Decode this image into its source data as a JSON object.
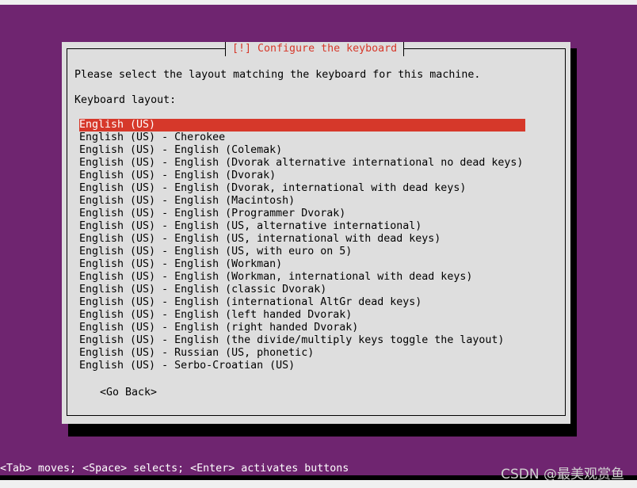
{
  "dialog": {
    "title": "[!] Configure the keyboard",
    "prompt": "Please select the layout matching the keyboard for this machine.",
    "list_label": "Keyboard layout:",
    "selected_index": 0,
    "items": [
      "English (US)",
      "English (US) - Cherokee",
      "English (US) - English (Colemak)",
      "English (US) - English (Dvorak alternative international no dead keys)",
      "English (US) - English (Dvorak)",
      "English (US) - English (Dvorak, international with dead keys)",
      "English (US) - English (Macintosh)",
      "English (US) - English (Programmer Dvorak)",
      "English (US) - English (US, alternative international)",
      "English (US) - English (US, international with dead keys)",
      "English (US) - English (US, with euro on 5)",
      "English (US) - English (Workman)",
      "English (US) - English (Workman, international with dead keys)",
      "English (US) - English (classic Dvorak)",
      "English (US) - English (international AltGr dead keys)",
      "English (US) - English (left handed Dvorak)",
      "English (US) - English (right handed Dvorak)",
      "English (US) - English (the divide/multiply keys toggle the layout)",
      "English (US) - Russian (US, phonetic)",
      "English (US) - Serbo-Croatian (US)"
    ],
    "go_back_label": "<Go Back>"
  },
  "status_line": "<Tab> moves; <Space> selects; <Enter> activates buttons",
  "watermark": "CSDN @最美观赏鱼",
  "colors": {
    "background": "#6f2570",
    "accent": "#d6382a",
    "dialog": "#dedede"
  }
}
